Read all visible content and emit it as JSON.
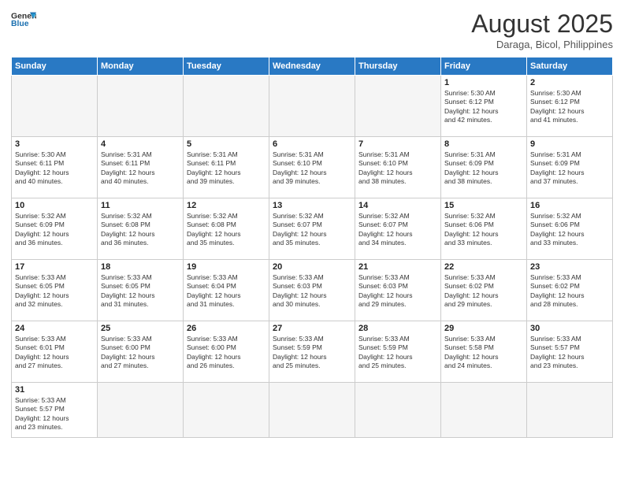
{
  "header": {
    "logo_line1": "General",
    "logo_line2": "Blue",
    "month_year": "August 2025",
    "location": "Daraga, Bicol, Philippines"
  },
  "weekdays": [
    "Sunday",
    "Monday",
    "Tuesday",
    "Wednesday",
    "Thursday",
    "Friday",
    "Saturday"
  ],
  "days": [
    {
      "date": "",
      "info": ""
    },
    {
      "date": "",
      "info": ""
    },
    {
      "date": "",
      "info": ""
    },
    {
      "date": "",
      "info": ""
    },
    {
      "date": "",
      "info": ""
    },
    {
      "date": "1",
      "info": "Sunrise: 5:30 AM\nSunset: 6:12 PM\nDaylight: 12 hours\nand 42 minutes."
    },
    {
      "date": "2",
      "info": "Sunrise: 5:30 AM\nSunset: 6:12 PM\nDaylight: 12 hours\nand 41 minutes."
    },
    {
      "date": "3",
      "info": "Sunrise: 5:30 AM\nSunset: 6:11 PM\nDaylight: 12 hours\nand 40 minutes."
    },
    {
      "date": "4",
      "info": "Sunrise: 5:31 AM\nSunset: 6:11 PM\nDaylight: 12 hours\nand 40 minutes."
    },
    {
      "date": "5",
      "info": "Sunrise: 5:31 AM\nSunset: 6:11 PM\nDaylight: 12 hours\nand 39 minutes."
    },
    {
      "date": "6",
      "info": "Sunrise: 5:31 AM\nSunset: 6:10 PM\nDaylight: 12 hours\nand 39 minutes."
    },
    {
      "date": "7",
      "info": "Sunrise: 5:31 AM\nSunset: 6:10 PM\nDaylight: 12 hours\nand 38 minutes."
    },
    {
      "date": "8",
      "info": "Sunrise: 5:31 AM\nSunset: 6:09 PM\nDaylight: 12 hours\nand 38 minutes."
    },
    {
      "date": "9",
      "info": "Sunrise: 5:31 AM\nSunset: 6:09 PM\nDaylight: 12 hours\nand 37 minutes."
    },
    {
      "date": "10",
      "info": "Sunrise: 5:32 AM\nSunset: 6:09 PM\nDaylight: 12 hours\nand 36 minutes."
    },
    {
      "date": "11",
      "info": "Sunrise: 5:32 AM\nSunset: 6:08 PM\nDaylight: 12 hours\nand 36 minutes."
    },
    {
      "date": "12",
      "info": "Sunrise: 5:32 AM\nSunset: 6:08 PM\nDaylight: 12 hours\nand 35 minutes."
    },
    {
      "date": "13",
      "info": "Sunrise: 5:32 AM\nSunset: 6:07 PM\nDaylight: 12 hours\nand 35 minutes."
    },
    {
      "date": "14",
      "info": "Sunrise: 5:32 AM\nSunset: 6:07 PM\nDaylight: 12 hours\nand 34 minutes."
    },
    {
      "date": "15",
      "info": "Sunrise: 5:32 AM\nSunset: 6:06 PM\nDaylight: 12 hours\nand 33 minutes."
    },
    {
      "date": "16",
      "info": "Sunrise: 5:32 AM\nSunset: 6:06 PM\nDaylight: 12 hours\nand 33 minutes."
    },
    {
      "date": "17",
      "info": "Sunrise: 5:33 AM\nSunset: 6:05 PM\nDaylight: 12 hours\nand 32 minutes."
    },
    {
      "date": "18",
      "info": "Sunrise: 5:33 AM\nSunset: 6:05 PM\nDaylight: 12 hours\nand 31 minutes."
    },
    {
      "date": "19",
      "info": "Sunrise: 5:33 AM\nSunset: 6:04 PM\nDaylight: 12 hours\nand 31 minutes."
    },
    {
      "date": "20",
      "info": "Sunrise: 5:33 AM\nSunset: 6:03 PM\nDaylight: 12 hours\nand 30 minutes."
    },
    {
      "date": "21",
      "info": "Sunrise: 5:33 AM\nSunset: 6:03 PM\nDaylight: 12 hours\nand 29 minutes."
    },
    {
      "date": "22",
      "info": "Sunrise: 5:33 AM\nSunset: 6:02 PM\nDaylight: 12 hours\nand 29 minutes."
    },
    {
      "date": "23",
      "info": "Sunrise: 5:33 AM\nSunset: 6:02 PM\nDaylight: 12 hours\nand 28 minutes."
    },
    {
      "date": "24",
      "info": "Sunrise: 5:33 AM\nSunset: 6:01 PM\nDaylight: 12 hours\nand 27 minutes."
    },
    {
      "date": "25",
      "info": "Sunrise: 5:33 AM\nSunset: 6:00 PM\nDaylight: 12 hours\nand 27 minutes."
    },
    {
      "date": "26",
      "info": "Sunrise: 5:33 AM\nSunset: 6:00 PM\nDaylight: 12 hours\nand 26 minutes."
    },
    {
      "date": "27",
      "info": "Sunrise: 5:33 AM\nSunset: 5:59 PM\nDaylight: 12 hours\nand 25 minutes."
    },
    {
      "date": "28",
      "info": "Sunrise: 5:33 AM\nSunset: 5:59 PM\nDaylight: 12 hours\nand 25 minutes."
    },
    {
      "date": "29",
      "info": "Sunrise: 5:33 AM\nSunset: 5:58 PM\nDaylight: 12 hours\nand 24 minutes."
    },
    {
      "date": "30",
      "info": "Sunrise: 5:33 AM\nSunset: 5:57 PM\nDaylight: 12 hours\nand 23 minutes."
    },
    {
      "date": "31",
      "info": "Sunrise: 5:33 AM\nSunset: 5:57 PM\nDaylight: 12 hours\nand 23 minutes."
    }
  ]
}
